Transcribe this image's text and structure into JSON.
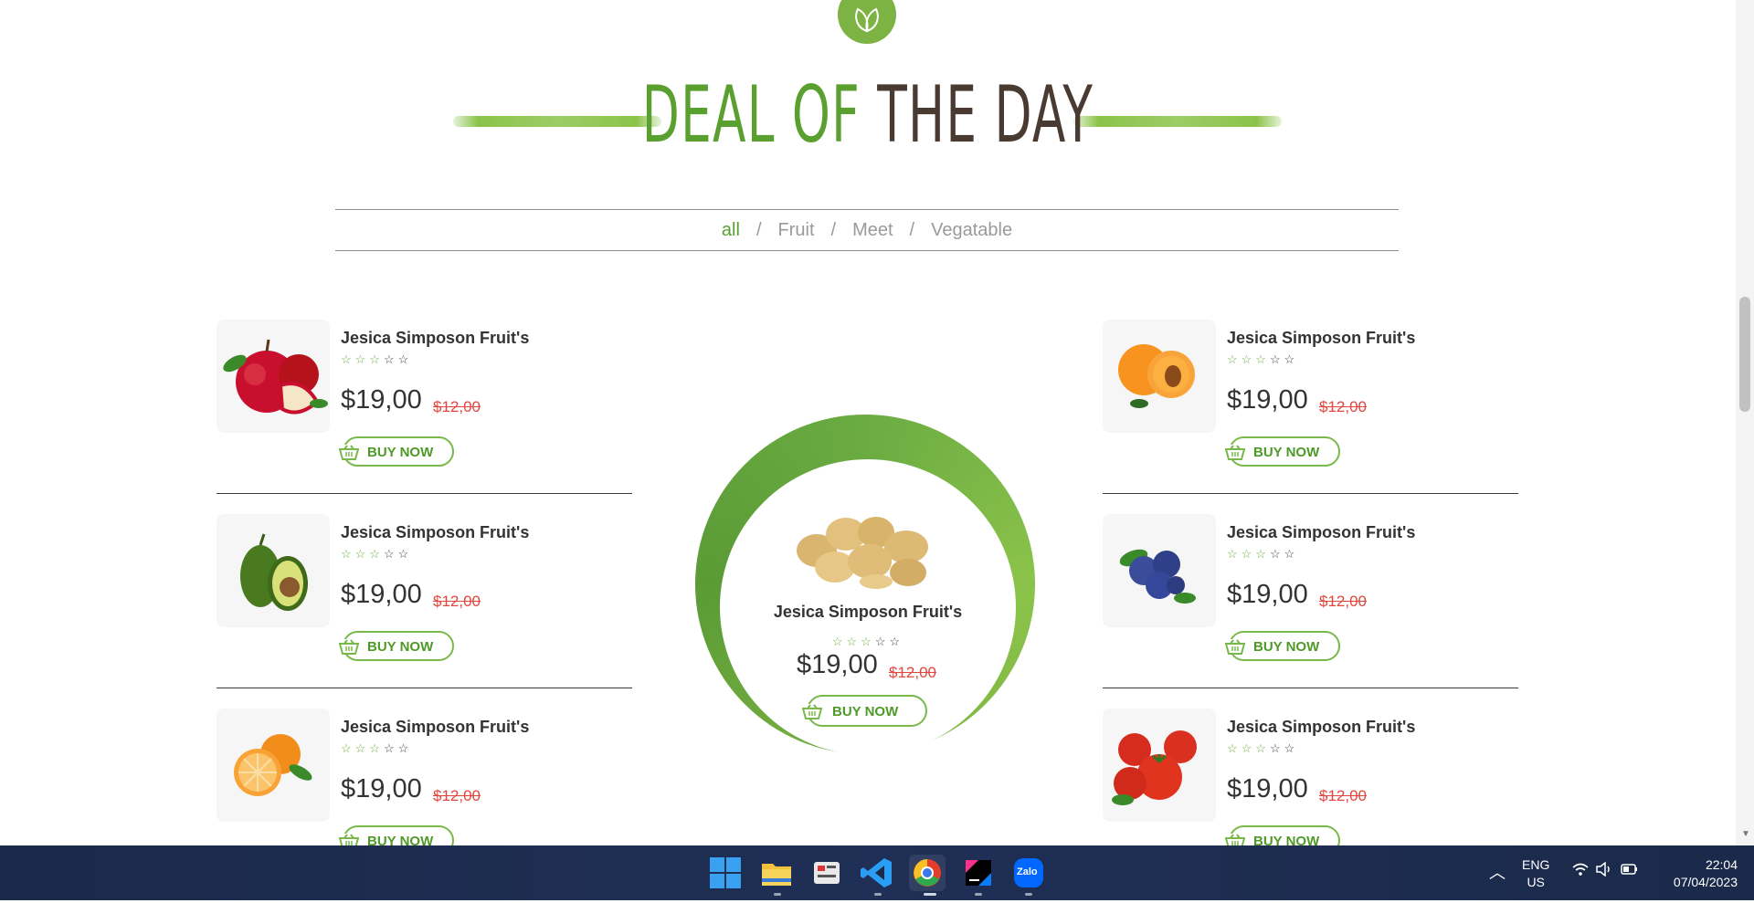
{
  "section": {
    "title_part1": "DEAL OF",
    "title_part2": "THE DAY"
  },
  "filters": [
    {
      "label": "all",
      "active": true
    },
    {
      "label": "Fruit",
      "active": false
    },
    {
      "label": "Meet",
      "active": false
    },
    {
      "label": "Vegatable",
      "active": false
    }
  ],
  "filter_separator": "/",
  "products_left": [
    {
      "name": "Jesica Simposon Fruit's",
      "rating": 3,
      "price": "$19,00",
      "old_price": "$12,00",
      "button": "BUY NOW",
      "image": "apple"
    },
    {
      "name": "Jesica Simposon Fruit's",
      "rating": 3,
      "price": "$19,00",
      "old_price": "$12,00",
      "button": "BUY NOW",
      "image": "avocado"
    },
    {
      "name": "Jesica Simposon Fruit's",
      "rating": 3,
      "price": "$19,00",
      "old_price": "$12,00",
      "button": "BUY NOW",
      "image": "orange"
    }
  ],
  "products_right": [
    {
      "name": "Jesica Simposon Fruit's",
      "rating": 3,
      "price": "$19,00",
      "old_price": "$12,00",
      "button": "BUY NOW",
      "image": "apricot"
    },
    {
      "name": "Jesica Simposon Fruit's",
      "rating": 3,
      "price": "$19,00",
      "old_price": "$12,00",
      "button": "BUY NOW",
      "image": "blueberry"
    },
    {
      "name": "Jesica Simposon Fruit's",
      "rating": 3,
      "price": "$19,00",
      "old_price": "$12,00",
      "button": "BUY NOW",
      "image": "tomato"
    }
  ],
  "featured": {
    "name": "Jesica Simposon Fruit's",
    "rating": 3,
    "price": "$19,00",
    "old_price": "$12,00",
    "button": "BUY NOW",
    "image": "potato"
  },
  "rating_max": 5,
  "colors": {
    "accent": "#5aa030",
    "title_dark": "#4a3b32",
    "sale": "#e0483d"
  },
  "taskbar": {
    "apps": [
      "windows-start-icon",
      "file-explorer-icon",
      "snipping-tool-icon",
      "vscode-icon",
      "chrome-icon",
      "intellij-icon",
      "zalo-icon"
    ],
    "zalo_label": "Zalo",
    "language": "ENG",
    "region": "US",
    "time": "22:04",
    "date": "07/04/2023"
  }
}
